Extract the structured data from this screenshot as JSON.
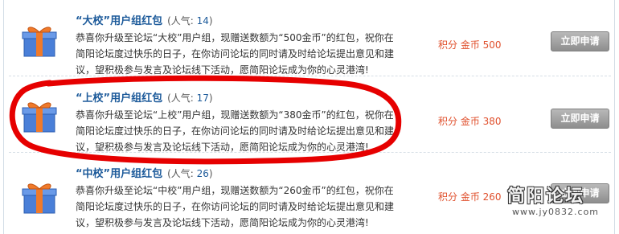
{
  "packages": [
    {
      "title": "“大校”用户组红包",
      "popularity_label": "(人气: ",
      "popularity": "14",
      "popularity_close": ")",
      "desc_lines": [
        "恭喜你升级至论坛“大校”用户组，现赠送数额为“500金币”的红包，祝你在",
        "简阳论坛度过快乐的日子，在你访问论坛的同时请及时给论坛提出意见和建",
        "议，望积极参与发言及论坛线下活动，愿简阳论坛成为你的心灵港湾!"
      ],
      "price": "积分 金币 500",
      "button": "立即申请"
    },
    {
      "title": "“上校”用户组红包",
      "popularity_label": "(人气: ",
      "popularity": "17",
      "popularity_close": ")",
      "desc_lines": [
        "恭喜你升级至论坛“上校”用户组，现赠送数额为“380金币”的红包，祝你在",
        "简阳论坛度过快乐的日子，在你访问论坛的同时请及时给论坛提出意见和建",
        "议，望积极参与发言及论坛线下活动，愿简阳论坛成为你的心灵港湾!"
      ],
      "price": "积分 金币 380",
      "button": "立即申请"
    },
    {
      "title": "“中校”用户组红包",
      "popularity_label": "(人气: ",
      "popularity": "26",
      "popularity_close": ")",
      "desc_lines": [
        "恭喜你升级至论坛“中校”用户组，现赠送数额为“260金币”的红包，祝你在",
        "简阳论坛度过快乐的日子，在你访问论坛的同时请及时给论坛提出意见和建",
        "议，望积极参与发言及论坛线下活动，愿简阳论坛成为你的心灵港湾!"
      ],
      "price": "积分 金币 260",
      "button": "立即申请"
    }
  ],
  "watermark": {
    "title": "简阳论坛",
    "url": "www.jy0832.com"
  },
  "colors": {
    "title": "#1c5a9a",
    "price": "#e0502d",
    "highlight": "#e60000",
    "button": "#9e9e9e"
  },
  "icons": {
    "gift": "gift-box-icon"
  }
}
